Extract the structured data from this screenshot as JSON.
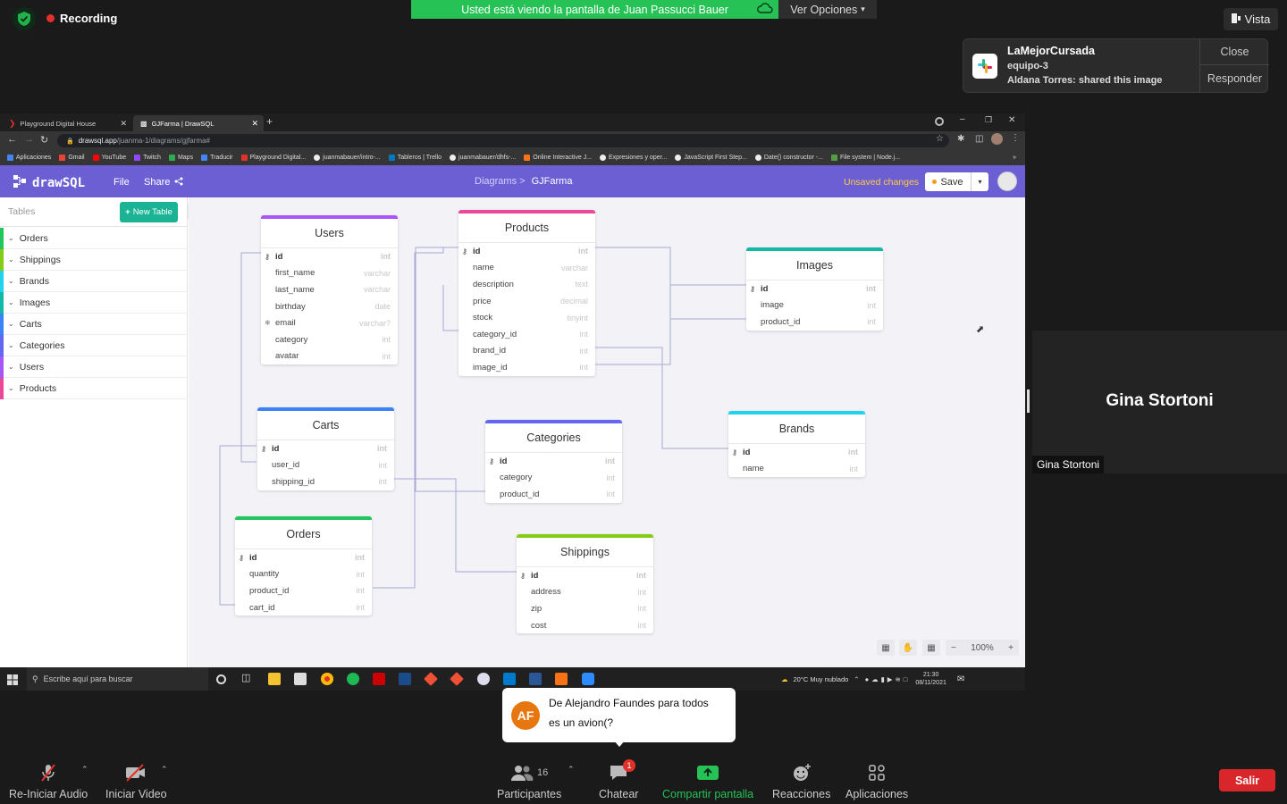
{
  "zoom": {
    "recording": "Recording",
    "share_banner": "Usted está viendo la pantalla de Juan Passucci Bauer",
    "view_options": "Ver Opciones",
    "vista": "Vista",
    "notification": {
      "title": "LaMejorCursada",
      "channel": "equipo-3",
      "message": "Aldana Torres: shared this image",
      "close": "Close",
      "reply": "Responder"
    },
    "participant_tile": {
      "name": "Gina Stortoni",
      "tag": "Gina Stortoni"
    },
    "chat_popup": {
      "avatar": "AF",
      "from": "De Alejandro Faundes para todos",
      "message": "es un avion(?"
    },
    "toolbar": {
      "audio": "Re-Iniciar Audio",
      "video": "Iniciar Video",
      "participants": "Participantes",
      "participants_count": "16",
      "chat": "Chatear",
      "chat_badge": "1",
      "share": "Compartir pantalla",
      "reactions": "Reacciones",
      "apps": "Aplicaciones",
      "leave": "Salir"
    }
  },
  "browser": {
    "tabs": [
      {
        "label": "Playground Digital House"
      },
      {
        "label": "GJFarma | DrawSQL"
      }
    ],
    "url_host": "drawsql.app",
    "url_path": "/juanma-1/diagrams/gjfarma#",
    "bookmarks": [
      "Aplicaciones",
      "Gmail",
      "YouTube",
      "Twitch",
      "Maps",
      "Traducir",
      "Playground Digital...",
      "juanmabauer/intro-...",
      "Tableros | Trello",
      "juanmabauer/dhfs-...",
      "Online Interactive J...",
      "Expresiones y oper...",
      "JavaScript First Step...",
      "Date() constructor -...",
      "File system | Node.j..."
    ],
    "more": "»"
  },
  "drawsql": {
    "logo": "drawSQL",
    "menu": {
      "file": "File",
      "share": "Share"
    },
    "breadcrumb": {
      "parent": "Diagrams >",
      "current": "GJFarma"
    },
    "unsaved": "Unsaved changes",
    "save": "Save",
    "sidebar": {
      "search_placeholder": "Tables",
      "new_table": "New Table",
      "items": [
        {
          "label": "Orders",
          "color": "#22c55e"
        },
        {
          "label": "Shippings",
          "color": "#84cc16"
        },
        {
          "label": "Brands",
          "color": "#22d3ee"
        },
        {
          "label": "Images",
          "color": "#14b8a6"
        },
        {
          "label": "Carts",
          "color": "#3b82f6"
        },
        {
          "label": "Categories",
          "color": "#6366f1"
        },
        {
          "label": "Users",
          "color": "#a855f7"
        },
        {
          "label": "Products",
          "color": "#ec4899"
        }
      ]
    },
    "zoom_level": "100%",
    "tables": {
      "users": {
        "name": "Users",
        "color": "#a855f7",
        "columns": [
          {
            "name": "id",
            "type": "int"
          },
          {
            "name": "first_name",
            "type": "varchar"
          },
          {
            "name": "last_name",
            "type": "varchar"
          },
          {
            "name": "birthday",
            "type": "date"
          },
          {
            "name": "email",
            "type": "varchar?"
          },
          {
            "name": "category",
            "type": "int"
          },
          {
            "name": "avatar",
            "type": "int"
          }
        ]
      },
      "products": {
        "name": "Products",
        "color": "#ec4899",
        "columns": [
          {
            "name": "id",
            "type": "int"
          },
          {
            "name": "name",
            "type": "varchar"
          },
          {
            "name": "description",
            "type": "text"
          },
          {
            "name": "price",
            "type": "decimal"
          },
          {
            "name": "stock",
            "type": "tinyint"
          },
          {
            "name": "category_id",
            "type": "int"
          },
          {
            "name": "brand_id",
            "type": "int"
          },
          {
            "name": "image_id",
            "type": "int"
          }
        ]
      },
      "images": {
        "name": "Images",
        "color": "#14b8a6",
        "columns": [
          {
            "name": "id",
            "type": "int"
          },
          {
            "name": "image",
            "type": "int"
          },
          {
            "name": "product_id",
            "type": "int"
          }
        ]
      },
      "carts": {
        "name": "Carts",
        "color": "#3b82f6",
        "columns": [
          {
            "name": "id",
            "type": "int"
          },
          {
            "name": "user_id",
            "type": "int"
          },
          {
            "name": "shipping_id",
            "type": "int"
          }
        ]
      },
      "categories": {
        "name": "Categories",
        "color": "#6366f1",
        "columns": [
          {
            "name": "id",
            "type": "int"
          },
          {
            "name": "category",
            "type": "int"
          },
          {
            "name": "product_id",
            "type": "int"
          }
        ]
      },
      "brands": {
        "name": "Brands",
        "color": "#22d3ee",
        "columns": [
          {
            "name": "id",
            "type": "int"
          },
          {
            "name": "name",
            "type": "int"
          }
        ]
      },
      "orders": {
        "name": "Orders",
        "color": "#22c55e",
        "columns": [
          {
            "name": "id",
            "type": "int"
          },
          {
            "name": "quantity",
            "type": "int"
          },
          {
            "name": "product_id",
            "type": "int"
          },
          {
            "name": "cart_id",
            "type": "int"
          }
        ]
      },
      "shippings": {
        "name": "Shippings",
        "color": "#84cc16",
        "columns": [
          {
            "name": "id",
            "type": "int"
          },
          {
            "name": "address",
            "type": "int"
          },
          {
            "name": "zip",
            "type": "int"
          },
          {
            "name": "cost",
            "type": "int"
          }
        ]
      }
    }
  },
  "windows": {
    "search_placeholder": "Escribe aquí para buscar",
    "weather": "20°C  Muy nublado",
    "time": "21:30",
    "date": "08/11/2021"
  }
}
